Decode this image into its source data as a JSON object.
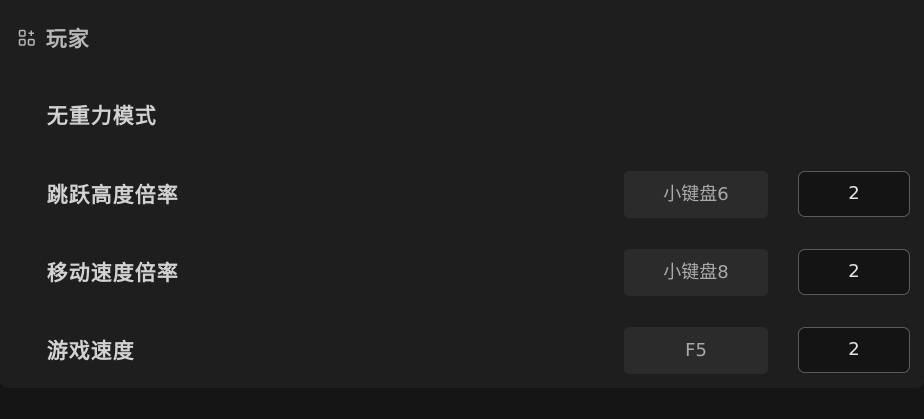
{
  "section": {
    "title": "玩家",
    "icon": "apps-add-icon"
  },
  "rows": [
    {
      "label": "无重力模式"
    },
    {
      "label": "跳跃高度倍率",
      "hotkey": "小键盘6",
      "value": "2"
    },
    {
      "label": "移动速度倍率",
      "hotkey": "小键盘8",
      "value": "2"
    },
    {
      "label": "游戏速度",
      "hotkey": "F5",
      "value": "2"
    }
  ]
}
